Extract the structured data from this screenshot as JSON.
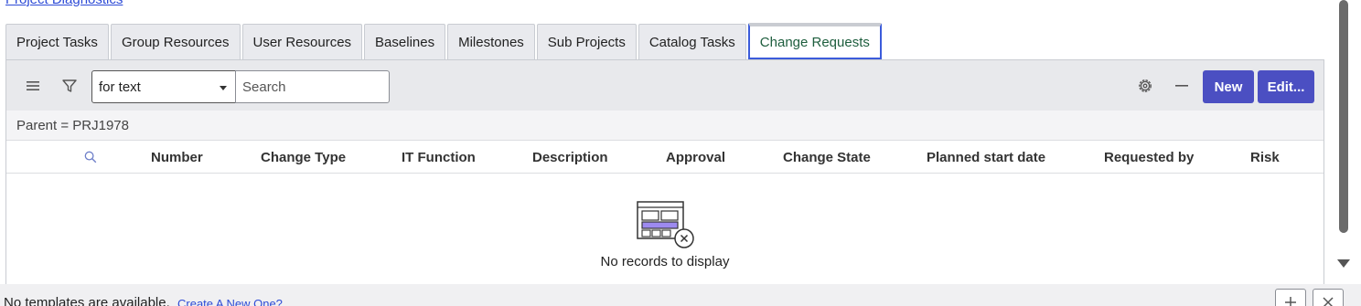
{
  "top_link": "Project Diagnostics",
  "tabs": [
    {
      "label": "Project Tasks",
      "active": false
    },
    {
      "label": "Group Resources",
      "active": false
    },
    {
      "label": "User Resources",
      "active": false
    },
    {
      "label": "Baselines",
      "active": false
    },
    {
      "label": "Milestones",
      "active": false
    },
    {
      "label": "Sub Projects",
      "active": false
    },
    {
      "label": "Catalog Tasks",
      "active": false
    },
    {
      "label": "Change Requests",
      "active": true
    }
  ],
  "toolbar": {
    "menu_icon": "hamburger-icon",
    "filter_icon": "funnel-icon",
    "search_field_select": "for text",
    "search_placeholder": "Search",
    "settings_icon": "gear-icon",
    "collapse_icon": "minus-icon",
    "new_label": "New",
    "edit_label": "Edit..."
  },
  "filter": "Parent = PRJ1978",
  "table": {
    "search_icon": "magnifier-icon",
    "columns": [
      "Number",
      "Change Type",
      "IT Function",
      "Description",
      "Approval",
      "Change State",
      "Planned start date",
      "Requested by",
      "Risk"
    ],
    "empty_message": "No records to display"
  },
  "footer": {
    "text": "No templates are available.",
    "link": "Create A New One?",
    "add_icon": "plus-icon",
    "close_icon": "close-icon"
  },
  "colors": {
    "accent": "#4b4fc2",
    "active_tab_border": "#3b5bdb",
    "active_tab_text": "#1e5e3e",
    "link": "#2d4bd6"
  }
}
